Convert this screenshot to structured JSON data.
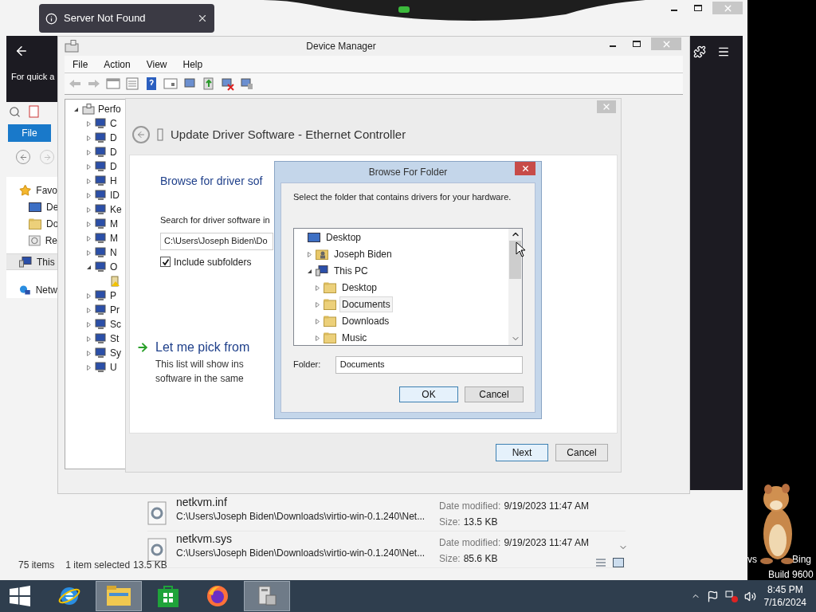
{
  "toast": {
    "message": "Server Not Found"
  },
  "browser": {
    "quick_text": "For quick a"
  },
  "explorer": {
    "ribbon_tab": "File",
    "nav_items": [
      {
        "label": "Favo",
        "kind": "favorites",
        "selected": false
      },
      {
        "label": "De",
        "kind": "desktop",
        "selected": false
      },
      {
        "label": "Do",
        "kind": "downloads",
        "selected": false
      },
      {
        "label": "Re",
        "kind": "recent",
        "selected": false
      },
      {
        "label": "This",
        "kind": "pc",
        "selected": true
      },
      {
        "label": "Netw",
        "kind": "network",
        "selected": false
      }
    ],
    "files": [
      {
        "name": "netkvm.inf",
        "path": "C:\\Users\\Joseph Biden\\Downloads\\virtio-win-0.1.240\\Net...",
        "date_label": "Date modified:",
        "date": "9/19/2023 11:47 AM",
        "size_label": "Size:",
        "size": "13.5 KB"
      },
      {
        "name": "netkvm.sys",
        "path": "C:\\Users\\Joseph Biden\\Downloads\\virtio-win-0.1.240\\Net...",
        "date_label": "Date modified:",
        "date": "9/19/2023 11:47 AM",
        "size_label": "Size:",
        "size": "85.6 KB"
      }
    ],
    "status": {
      "count": "75 items",
      "selection": "1 item selected",
      "size": "13.5 KB"
    }
  },
  "device_manager": {
    "title": "Device Manager",
    "menu": [
      "File",
      "Action",
      "View",
      "Help"
    ],
    "tree": {
      "label": "Perfo",
      "expanded": true,
      "children": [
        {
          "label": "C",
          "expanded": false
        },
        {
          "label": "D",
          "expanded": false
        },
        {
          "label": "D",
          "expanded": false
        },
        {
          "label": "D",
          "expanded": false
        },
        {
          "label": "H",
          "expanded": false
        },
        {
          "label": "ID",
          "expanded": false
        },
        {
          "label": "Ke",
          "expanded": false
        },
        {
          "label": "M",
          "expanded": false
        },
        {
          "label": "M",
          "expanded": false
        },
        {
          "label": "N",
          "expanded": false
        },
        {
          "label": "O",
          "expanded": true,
          "children": [
            {
              "kind": "warning-device"
            }
          ]
        },
        {
          "label": "P",
          "expanded": false
        },
        {
          "label": "Pr",
          "expanded": false
        },
        {
          "label": "Sc",
          "expanded": false
        },
        {
          "label": "St",
          "expanded": false
        },
        {
          "label": "Sy",
          "expanded": false
        },
        {
          "label": "U",
          "expanded": false
        }
      ]
    }
  },
  "wizard": {
    "title": "Update Driver Software - Ethernet Controller",
    "heading": "Browse for driver sof",
    "search_label": "Search for driver software in",
    "path": "C:\\Users\\Joseph Biden\\Do",
    "include_subfolders": {
      "label": "Include subfolders",
      "checked": true
    },
    "pick": {
      "title": "Let me pick from",
      "lines": [
        "This list will show ins",
        "software in the same"
      ]
    },
    "buttons": [
      {
        "label": "Next",
        "default": true
      },
      {
        "label": "Cancel",
        "default": false
      }
    ]
  },
  "browse_dialog": {
    "title": "Browse For Folder",
    "prompt": "Select the folder that contains drivers for your hardware.",
    "tree": [
      {
        "label": "Desktop",
        "kind": "desktop",
        "selected": false,
        "children": [
          {
            "label": "Joseph Biden",
            "kind": "user",
            "expanded": false,
            "selected": false
          },
          {
            "label": "This PC",
            "kind": "pc",
            "expanded": true,
            "selected": false,
            "children": [
              {
                "label": "Desktop",
                "kind": "folder",
                "expanded": false,
                "selected": false
              },
              {
                "label": "Documents",
                "kind": "folder",
                "expanded": false,
                "selected": true
              },
              {
                "label": "Downloads",
                "kind": "folder",
                "expanded": false,
                "selected": false
              },
              {
                "label": "Music",
                "kind": "folder",
                "expanded": false,
                "selected": false
              }
            ]
          }
        ]
      }
    ],
    "folder_label": "Folder:",
    "folder_value": "Documents",
    "buttons": [
      {
        "label": "OK",
        "default": true
      },
      {
        "label": "Cancel",
        "default": false
      }
    ]
  },
  "desktop": {
    "watermark_fragments": [
      "vs",
      "Bing"
    ],
    "build": "Build 9600"
  },
  "taskbar": {
    "apps": [
      {
        "kind": "ie",
        "selected": false
      },
      {
        "kind": "explorer",
        "selected": true
      },
      {
        "kind": "store",
        "selected": false
      },
      {
        "kind": "firefox",
        "selected": false
      },
      {
        "kind": "devmgr",
        "selected": true
      }
    ],
    "time": "8:45 PM",
    "date": "7/16/2024"
  }
}
